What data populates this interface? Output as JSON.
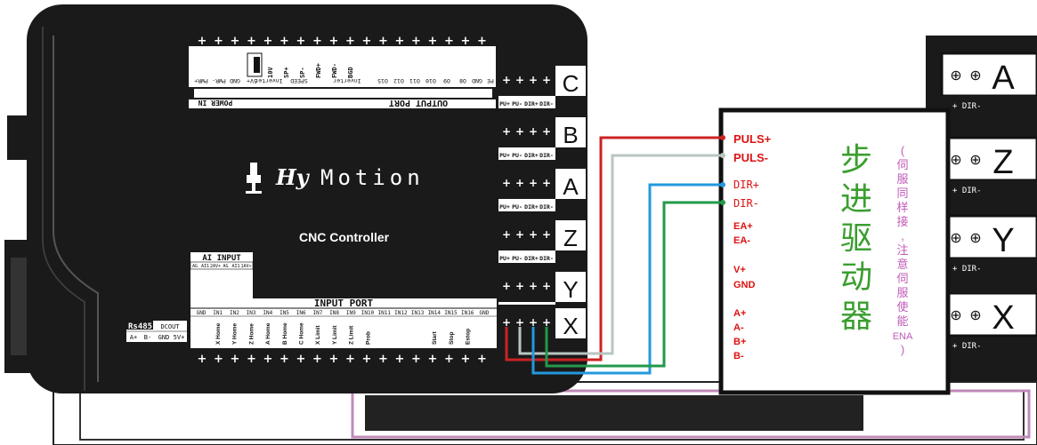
{
  "brand": {
    "logo_script": "Hy",
    "name": "Motion",
    "subtitle": "CNC Controller"
  },
  "power_in": {
    "label": "POWER IN",
    "pins": [
      "PWR+",
      "PWR-",
      "GND"
    ]
  },
  "output_port": {
    "label": "OUTPUT PORT",
    "top_pins": [
      "10V",
      "SP+",
      "SP-",
      "FWD+",
      "FWD-",
      "BGD"
    ],
    "bottom_labels": [
      "5V+",
      "Inverter",
      "SPEED",
      "Inverter",
      "O15",
      "O12",
      "O11",
      "O10",
      "O9",
      "O8",
      "GND",
      "PE"
    ]
  },
  "ai_input": {
    "label": "AI INPUT",
    "pins": [
      "AG",
      "AI1",
      "2AV+",
      "AG",
      "AI1",
      "1AV+"
    ]
  },
  "input_port": {
    "label": "INPUT PORT",
    "top_labels": [
      "GND",
      "IN1",
      "IN2",
      "IN3",
      "IN4",
      "IN5",
      "IN6",
      "IN7",
      "IN8",
      "IN9",
      "IN10",
      "IN11",
      "IN12",
      "IN13",
      "IN14",
      "IN15",
      "IN16",
      "GND"
    ],
    "functions": [
      "X Home",
      "Y Home",
      "Z Home",
      "A Home",
      "B Home",
      "C Home",
      "X Limit",
      "Y Limit",
      "Z Limit",
      "Prob",
      "",
      "",
      "",
      "Start",
      "Stop",
      "Estop"
    ]
  },
  "rs485": {
    "label": "Rs485",
    "pins": [
      "A+",
      "B-",
      "GND"
    ],
    "dcout_label": "DCOUT",
    "dcout_pin": "5V+"
  },
  "axis_terminals": [
    {
      "axis": "C",
      "pins": [
        "PU+",
        "PU-",
        "DIR+",
        "DIR-"
      ]
    },
    {
      "axis": "B",
      "pins": [
        "PU+",
        "PU-",
        "DIR+",
        "DIR-"
      ]
    },
    {
      "axis": "A",
      "pins": [
        "PU+",
        "PU-",
        "DIR+",
        "DIR-"
      ]
    },
    {
      "axis": "Z",
      "pins": [
        "PU+",
        "PU-",
        "DIR+",
        "DIR-"
      ]
    },
    {
      "axis": "Y",
      "pins": [
        "PU+",
        "PU-",
        "DIR+",
        "DIR-"
      ]
    },
    {
      "axis": "X",
      "pins": []
    }
  ],
  "right_axes": [
    {
      "axis": "A",
      "pins": "+ DIR-"
    },
    {
      "axis": "Z",
      "pins": "+ DIR-"
    },
    {
      "axis": "Y",
      "pins": "+ DIR-"
    },
    {
      "axis": "X",
      "pins": "+ DIR-"
    }
  ],
  "driver": {
    "title": "步进驱动器",
    "title_chars": [
      "步",
      "进",
      "驱",
      "动",
      "器"
    ],
    "note_chars": [
      "(",
      "伺",
      "服",
      "同",
      "样",
      "接",
      ",",
      "注",
      "意",
      "伺",
      "服",
      "使",
      "能",
      "ENA",
      ")"
    ],
    "terminals": {
      "puls_plus": "PULS+",
      "puls_minus": "PULS-",
      "dir_plus": "DIR+",
      "dir_minus": "DIR-",
      "ea_plus": "EA+",
      "ea_minus": "EA-",
      "v_plus": "V+",
      "gnd": "GND",
      "a_plus": "A+",
      "a_minus": "A-",
      "b_plus": "B+",
      "b_minus": "B-"
    }
  },
  "colors": {
    "board": "#1a1a1a",
    "wire_red": "#cc2222",
    "wire_gray": "#b9c6c0",
    "wire_blue": "#2299dd",
    "wire_green": "#22994a",
    "driver_title": "#3a9e2e",
    "driver_labels": "#dd1111",
    "driver_note": "#c05ab8",
    "rail_pink": "#c08ab8"
  }
}
